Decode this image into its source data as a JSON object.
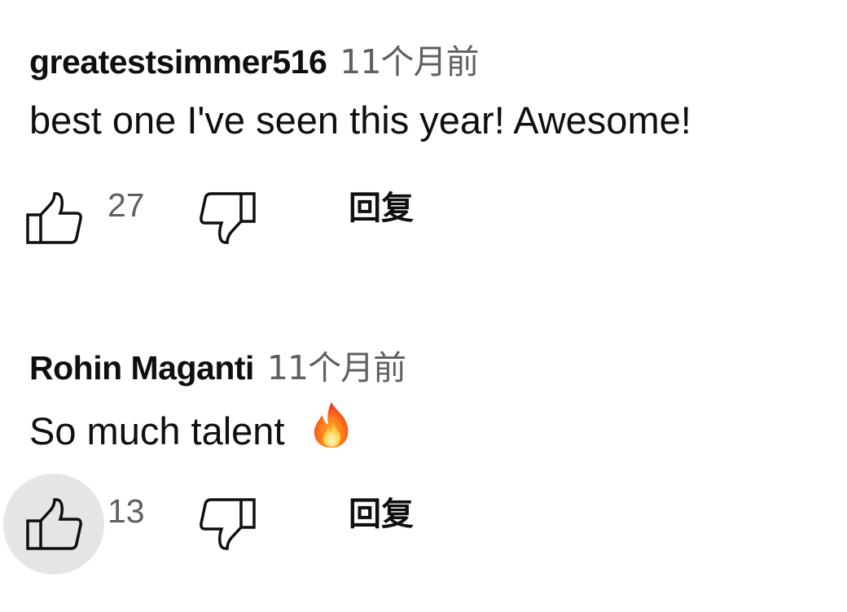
{
  "comments": [
    {
      "author": "greatestsimmer516",
      "time": "11个月前",
      "text": "best one I've seen this year! Awesome!",
      "likes": "27",
      "reply_label": "回复",
      "like_hovered": false
    },
    {
      "author": "Rohin Maganti",
      "time": "11个月前",
      "text": "So much talent",
      "emoji": "fire-emoji",
      "likes": "13",
      "reply_label": "回复",
      "like_hovered": true
    }
  ],
  "colors": {
    "text": "#0f0f0f",
    "secondary": "#606060",
    "hover_circle": "#e5e5e5"
  },
  "icons": {
    "like": "thumb-up-icon",
    "dislike": "thumb-down-icon"
  }
}
